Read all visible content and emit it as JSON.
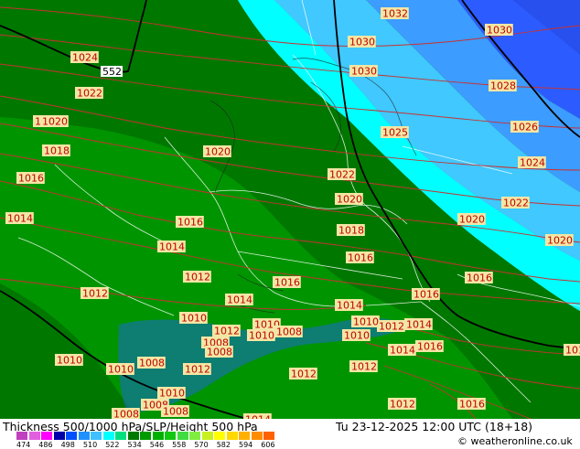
{
  "header": {
    "title": "Thickness 500/1000 hPa/SLP/Height 500 hPa",
    "datetime": "Tu 23-12-2025 12:00 UTC (18+18)",
    "credit": "© weatheronline.co.uk"
  },
  "legend": {
    "ticks": [
      "474",
      "486",
      "498",
      "510",
      "522",
      "534",
      "546",
      "558",
      "570",
      "582",
      "594",
      "606"
    ],
    "colors": [
      "#c040c0",
      "#e060e0",
      "#ff00ff",
      "#0000aa",
      "#0050ff",
      "#2090ff",
      "#40c0ff",
      "#00ffff",
      "#00e080",
      "#007a00",
      "#009a00",
      "#00b000",
      "#10c810",
      "#40dc40",
      "#80ee40",
      "#c8f020",
      "#ffff00",
      "#ffd800",
      "#ffb000",
      "#ff8c00",
      "#ff6000"
    ]
  },
  "map": {
    "colors": {
      "dark_blue": "#2c5cff",
      "mid_blue": "#3c9cff",
      "light_blue": "#40c8ff",
      "cyan": "#00ffff",
      "dark_green": "#007800",
      "green": "#008c00",
      "light_green": "#00a000",
      "lighter_green": "#00b400",
      "isobar": "#c83232",
      "border": "#ffffff",
      "height_line": "#000000"
    },
    "height_label": "552",
    "isobar_labels": [
      "1032",
      "1030",
      "1030",
      "1030",
      "1028",
      "1026",
      "1025",
      "1024",
      "1024",
      "1022",
      "1022",
      "1022",
      "1022",
      "1020",
      "1020",
      "1020",
      "1020",
      "1020",
      "1018",
      "1018",
      "1016",
      "1016",
      "1016",
      "1016",
      "1016",
      "1016",
      "1016",
      "1016",
      "1014",
      "1014",
      "1014",
      "1014",
      "1014",
      "1014",
      "1014",
      "1012",
      "1012",
      "1012",
      "1012",
      "1012",
      "1012",
      "1012",
      "1012",
      "1010",
      "1010",
      "1010",
      "1010",
      "1010",
      "1010",
      "1010",
      "1010",
      "1008",
      "1008",
      "1008",
      "1008",
      "1008",
      "1008",
      "1008",
      "1014"
    ]
  }
}
